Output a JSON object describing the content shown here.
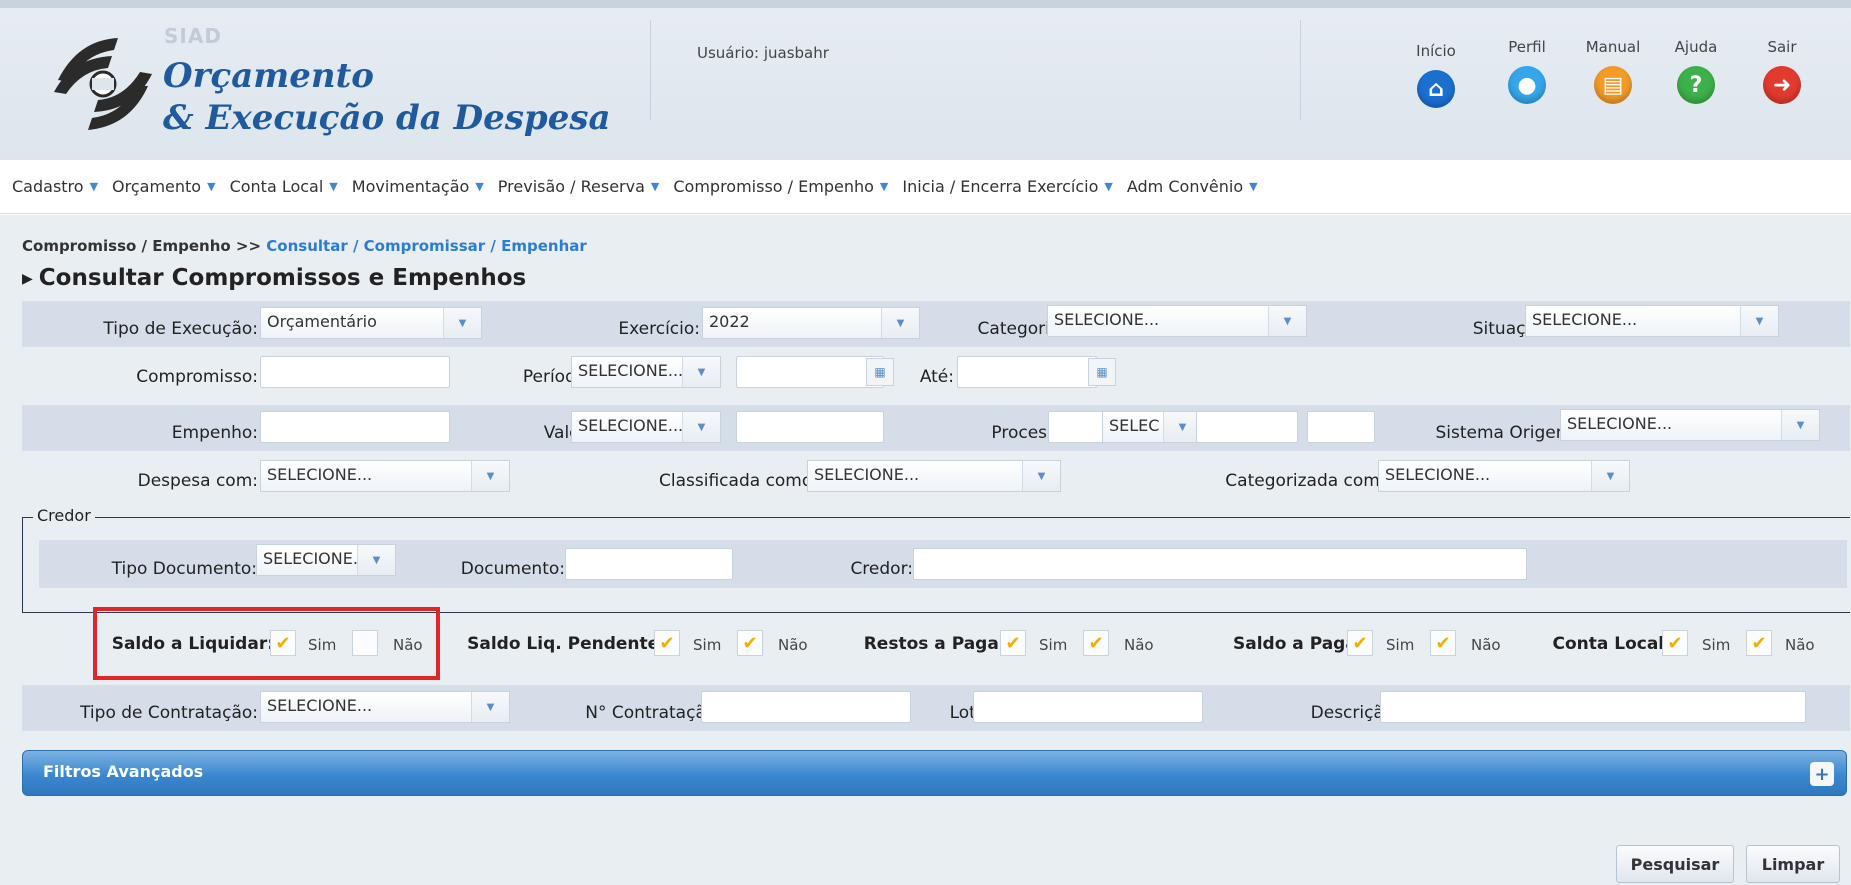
{
  "header": {
    "logo_tag": "SIAD",
    "logo_line1": "Orçamento",
    "logo_line2": "& Execução da Despesa",
    "user": "Usuário: juasbahr",
    "nav": [
      {
        "label": "Início",
        "icon": "home-icon",
        "color": "#1b6fd1",
        "glyph": "⌂"
      },
      {
        "label": "Perfil",
        "icon": "user-icon",
        "color": "#35a6ea",
        "glyph": "●"
      },
      {
        "label": "Manual",
        "icon": "manual-icon",
        "color": "#f39a27",
        "glyph": "▤"
      },
      {
        "label": "Ajuda",
        "icon": "help-icon",
        "color": "#3cb14a",
        "glyph": "?"
      },
      {
        "label": "Sair",
        "icon": "exit-icon",
        "color": "#e23a2e",
        "glyph": "➜"
      }
    ]
  },
  "menu": [
    "Cadastro",
    "Orçamento",
    "Conta Local",
    "Movimentação",
    "Previsão / Reserva",
    "Compromisso / Empenho",
    "Inicia / Encerra Exercício",
    "Adm Convênio"
  ],
  "breadcrumb": {
    "root": "Compromisso / Empenho >>",
    "current": "Consultar / Compromissar / Empenhar"
  },
  "page_title": "Consultar Compromissos e Empenhos",
  "form": {
    "tipo_execucao": {
      "label": "Tipo de Execução:",
      "value": "Orçamentário"
    },
    "exercicio": {
      "label": "Exercício:",
      "value": "2022"
    },
    "categoria": {
      "label": "Categoria:",
      "value": "SELECIONE..."
    },
    "situacao": {
      "label": "Situação:",
      "value": "SELECIONE..."
    },
    "compromisso": {
      "label": "Compromisso:"
    },
    "periodo": {
      "label": "Período:",
      "value": "SELECIONE..."
    },
    "ate": {
      "label": "Até:"
    },
    "empenho": {
      "label": "Empenho:"
    },
    "valor": {
      "label": "Valor:",
      "value": "SELECIONE..."
    },
    "processo": {
      "label": "Processo:",
      "value": "SELEC",
      "slash": "/"
    },
    "sistema_origem": {
      "label": "Sistema Origem:",
      "value": "SELECIONE..."
    },
    "despesa_com": {
      "label": "Despesa com:",
      "value": "SELECIONE..."
    },
    "classificada_como": {
      "label": "Classificada como:",
      "value": "SELECIONE..."
    },
    "categorizada_como": {
      "label": "Categorizada como:",
      "value": "SELECIONE..."
    },
    "credor_group": "Credor",
    "tipo_documento": {
      "label": "Tipo Documento:",
      "value": "SELECIONE..."
    },
    "documento": {
      "label": "Documento:"
    },
    "credor": {
      "label": "Credor:"
    },
    "saldo_liquidar": {
      "label": "Saldo a Liquidar:",
      "sim": "Sim",
      "nao": "Não",
      "sim_checked": true,
      "nao_checked": false
    },
    "saldo_liq_pendente": {
      "label": "Saldo Liq. Pendente:",
      "sim": "Sim",
      "nao": "Não",
      "sim_checked": true,
      "nao_checked": true
    },
    "restos_pagar": {
      "label": "Restos a Pagar:",
      "sim": "Sim",
      "nao": "Não",
      "sim_checked": true,
      "nao_checked": true
    },
    "saldo_pagar": {
      "label": "Saldo a Pagar:",
      "sim": "Sim",
      "nao": "Não",
      "sim_checked": true,
      "nao_checked": true
    },
    "conta_local": {
      "label": "Conta Local?",
      "sim": "Sim",
      "nao": "Não",
      "sim_checked": true,
      "nao_checked": true
    },
    "tipo_contratacao": {
      "label": "Tipo de Contratação:",
      "value": "SELECIONE..."
    },
    "n_contratacao": {
      "label": "N° Contratação:"
    },
    "lote": {
      "label": "Lote:"
    },
    "descricao": {
      "label": "Descrição:"
    }
  },
  "advanced": {
    "label": "Filtros Avançados"
  },
  "buttons": {
    "search": "Pesquisar",
    "clear": "Limpar"
  }
}
